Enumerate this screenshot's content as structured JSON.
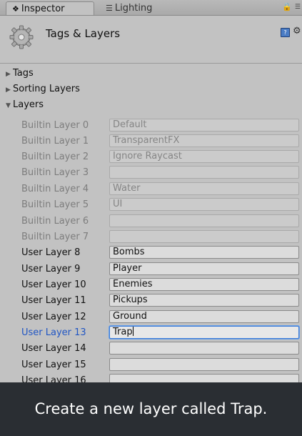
{
  "tabs": [
    {
      "label": "Inspector",
      "icon": "info-icon",
      "active": true
    },
    {
      "label": "Lighting",
      "icon": "lighting-icon",
      "active": false
    }
  ],
  "header": {
    "title": "Tags & Layers"
  },
  "foldouts": {
    "tags": "Tags",
    "sorting_layers": "Sorting Layers",
    "layers": "Layers"
  },
  "layers": [
    {
      "label": "Builtin Layer 0",
      "value": "Default"
    },
    {
      "label": "Builtin Layer 1",
      "value": "TransparentFX"
    },
    {
      "label": "Builtin Layer 2",
      "value": "Ignore Raycast"
    },
    {
      "label": "Builtin Layer 3",
      "value": ""
    },
    {
      "label": "Builtin Layer 4",
      "value": "Water"
    },
    {
      "label": "Builtin Layer 5",
      "value": "UI"
    },
    {
      "label": "Builtin Layer 6",
      "value": ""
    },
    {
      "label": "Builtin Layer 7",
      "value": ""
    },
    {
      "label": "User Layer 8",
      "value": "Bombs"
    },
    {
      "label": "User Layer 9",
      "value": "Player"
    },
    {
      "label": "User Layer 10",
      "value": "Enemies"
    },
    {
      "label": "User Layer 11",
      "value": "Pickups"
    },
    {
      "label": "User Layer 12",
      "value": "Ground"
    },
    {
      "label": "User Layer 13",
      "value": "Trap"
    },
    {
      "label": "User Layer 14",
      "value": ""
    },
    {
      "label": "User Layer 15",
      "value": ""
    },
    {
      "label": "User Layer 16",
      "value": ""
    }
  ],
  "focused_layer_index": 13,
  "caption": "Create a new layer called Trap.",
  "colors": {
    "focus_accent": "#3d7bd6",
    "caption_bg": "#2a2e33"
  }
}
